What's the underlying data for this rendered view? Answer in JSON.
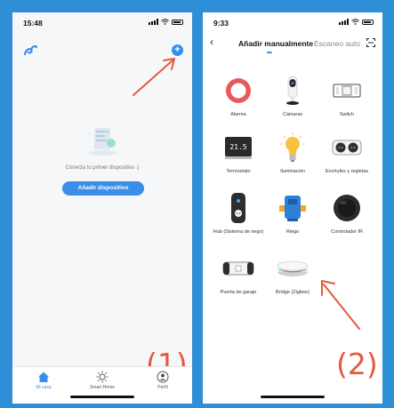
{
  "screen1": {
    "status_time": "15:48",
    "empty_message": "Conecta tu primer dispositivo :)",
    "add_device_button": "Añadir dispositivo",
    "tabs": [
      {
        "label": "Mi casa"
      },
      {
        "label": "Smart Home"
      },
      {
        "label": "Perfil"
      }
    ],
    "step_label": "(1)"
  },
  "screen2": {
    "status_time": "9:33",
    "tab_manual": "Añadir manualmente",
    "tab_auto": "Escaneo auto",
    "devices": [
      {
        "label": "Alarma",
        "icon": "alarm-icon"
      },
      {
        "label": "Cámaras",
        "icon": "camera-icon"
      },
      {
        "label": "Switch",
        "icon": "switch-icon"
      },
      {
        "label": "Termostato",
        "icon": "thermostat-icon"
      },
      {
        "label": "Iluminación",
        "icon": "bulb-icon"
      },
      {
        "label": "Enchufes y regletas",
        "icon": "plug-icon"
      },
      {
        "label": "Hub (Sistema de riego)",
        "icon": "hub-icon"
      },
      {
        "label": "Riego",
        "icon": "irrigation-icon"
      },
      {
        "label": "Controlador IR",
        "icon": "ir-controller-icon"
      },
      {
        "label": "Puerta de garaje",
        "icon": "garage-icon"
      },
      {
        "label": "Bridge (Zigbee)",
        "icon": "bridge-icon"
      }
    ],
    "thermostat_display": "21.5",
    "step_label": "(2)"
  },
  "colors": {
    "background": "#2f8fd6",
    "accent": "#3b8ee8",
    "annotation": "#e45a3b"
  }
}
